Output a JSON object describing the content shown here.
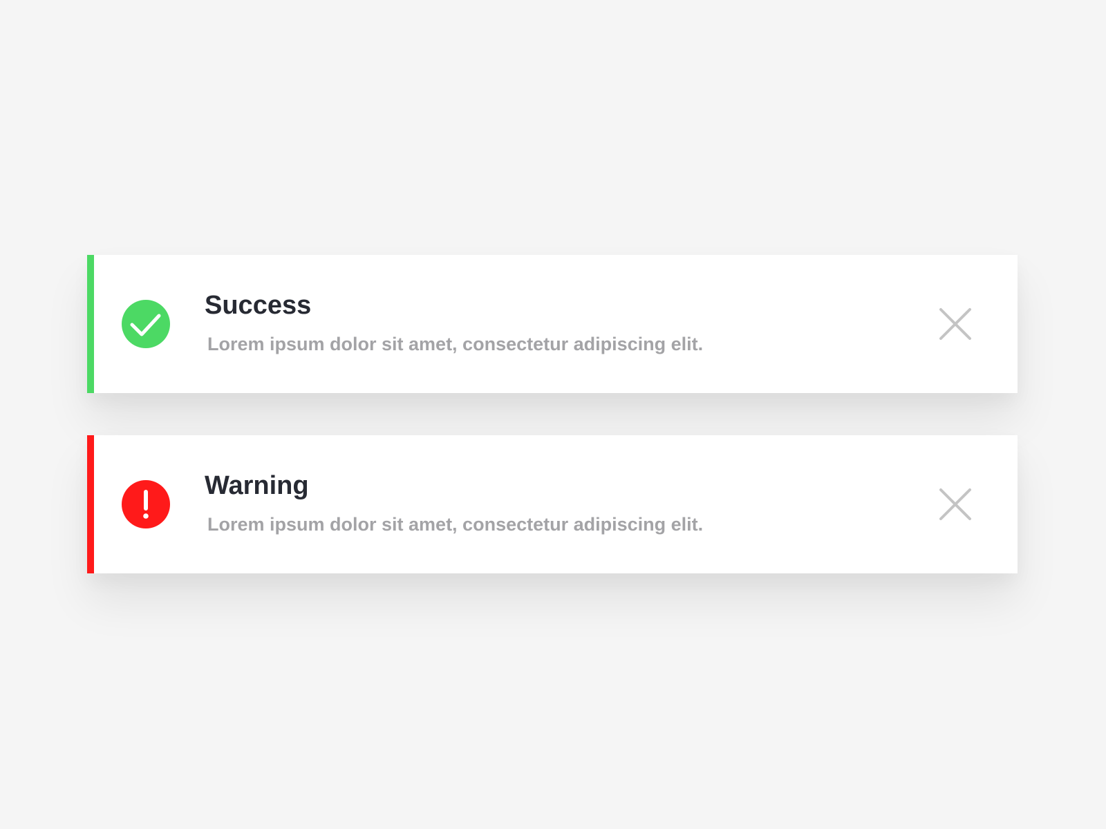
{
  "alerts": [
    {
      "type": "success",
      "title": "Success",
      "message": "Lorem ipsum dolor sit amet, consectetur adipiscing elit.",
      "accent_color": "#4cd964",
      "icon": "check-circle-icon",
      "close_icon": "close-icon"
    },
    {
      "type": "warning",
      "title": "Warning",
      "message": "Lorem ipsum dolor sit amet, consectetur adipiscing elit.",
      "accent_color": "#ff1a1a",
      "icon": "exclamation-circle-icon",
      "close_icon": "close-icon"
    }
  ],
  "colors": {
    "background": "#f5f5f5",
    "card": "#ffffff",
    "title_text": "#272a33",
    "message_text": "#a3a3a6",
    "close_icon": "#c4c4c4"
  }
}
